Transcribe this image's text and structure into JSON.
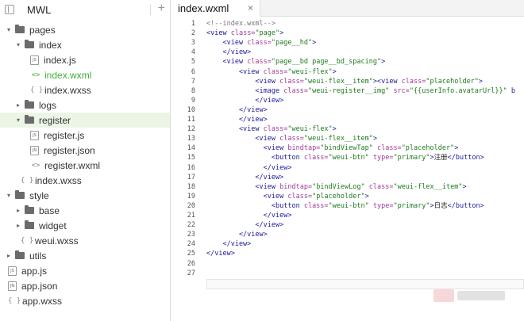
{
  "project": {
    "name": "MWL",
    "add_symbol": "+"
  },
  "tree": [
    {
      "label": "pages",
      "kind": "folder",
      "arrow": "▾",
      "depth": 0
    },
    {
      "label": "index",
      "kind": "folder",
      "arrow": "▾",
      "depth": 1
    },
    {
      "label": "index.js",
      "kind": "file",
      "badge": "JS",
      "depth": 2
    },
    {
      "label": "index.wxml",
      "kind": "code",
      "badge": "<>",
      "depth": 2,
      "active": true
    },
    {
      "label": "index.wxss",
      "kind": "brace",
      "badge": "{ }",
      "depth": 2
    },
    {
      "label": "logs",
      "kind": "folder",
      "arrow": "▸",
      "depth": 1
    },
    {
      "label": "register",
      "kind": "folder",
      "arrow": "▾",
      "depth": 1,
      "selected": true
    },
    {
      "label": "register.js",
      "kind": "file",
      "badge": "JS",
      "depth": 2
    },
    {
      "label": "register.json",
      "kind": "file",
      "badge": "JN",
      "depth": 2
    },
    {
      "label": "register.wxml",
      "kind": "code",
      "badge": "<>",
      "depth": 2
    },
    {
      "label": "index.wxss",
      "kind": "brace",
      "badge": "{ }",
      "depth": 1
    },
    {
      "label": "style",
      "kind": "folder",
      "arrow": "▾",
      "depth": 0
    },
    {
      "label": "base",
      "kind": "folder",
      "arrow": "▸",
      "depth": 1
    },
    {
      "label": "widget",
      "kind": "folder",
      "arrow": "▸",
      "depth": 1
    },
    {
      "label": "weui.wxss",
      "kind": "brace",
      "badge": "{ }",
      "depth": 1
    },
    {
      "label": "utils",
      "kind": "folder",
      "arrow": "▸",
      "depth": 0
    },
    {
      "label": "app.js",
      "kind": "file",
      "badge": "JS",
      "depth": 0
    },
    {
      "label": "app.json",
      "kind": "file",
      "badge": "JN",
      "depth": 0
    },
    {
      "label": "app.wxss",
      "kind": "brace",
      "badge": "{ }",
      "depth": 0
    }
  ],
  "editor": {
    "tab_label": "index.wxml",
    "tab_close": "×",
    "lines": [
      [
        [
          "cm",
          "<!--index.wxml-->"
        ]
      ],
      [
        [
          "tag",
          "<view "
        ],
        [
          "at",
          "class="
        ],
        [
          "st",
          "\"page\""
        ],
        [
          "tag",
          ">"
        ]
      ],
      [
        [
          "tag",
          "    <view "
        ],
        [
          "at",
          "class="
        ],
        [
          "st",
          "\"page__hd\""
        ],
        [
          "tag",
          ">"
        ]
      ],
      [
        [
          "tag",
          "    </view>"
        ]
      ],
      [
        [
          "tag",
          "    <view "
        ],
        [
          "at",
          "class="
        ],
        [
          "st",
          "\"page__bd page__bd_spacing\""
        ],
        [
          "tag",
          ">"
        ]
      ],
      [
        [
          "tag",
          "        <view "
        ],
        [
          "at",
          "class="
        ],
        [
          "st",
          "\"weui-flex\""
        ],
        [
          "tag",
          ">"
        ]
      ],
      [
        [
          "tag",
          "            <view "
        ],
        [
          "at",
          "class="
        ],
        [
          "st",
          "\"weui-flex__item\""
        ],
        [
          "tag",
          "><view "
        ],
        [
          "at",
          "class="
        ],
        [
          "st",
          "\"placeholder\""
        ],
        [
          "tag",
          ">"
        ]
      ],
      [
        [
          "tag",
          "            <image "
        ],
        [
          "at",
          "class="
        ],
        [
          "st",
          "\"weui-register__img\""
        ],
        [
          "tag",
          " "
        ],
        [
          "at",
          "src="
        ],
        [
          "st",
          "\"{{userInfo.avatarUrl}}\""
        ],
        [
          "tag",
          " b"
        ]
      ],
      [
        [
          "tag",
          "            </view>"
        ]
      ],
      [
        [
          "tag",
          "        </view>"
        ]
      ],
      [
        [
          "tag",
          "        </view>"
        ]
      ],
      [
        [
          "tag",
          "        <view "
        ],
        [
          "at",
          "class="
        ],
        [
          "st",
          "\"weui-flex\""
        ],
        [
          "tag",
          ">"
        ]
      ],
      [
        [
          "tag",
          "            <view "
        ],
        [
          "at",
          "class="
        ],
        [
          "st",
          "\"weui-flex__item\""
        ],
        [
          "tag",
          ">"
        ]
      ],
      [
        [
          "tag",
          "              <view "
        ],
        [
          "at",
          "bindtap="
        ],
        [
          "st",
          "\"bindViewTap\""
        ],
        [
          "tag",
          " "
        ],
        [
          "at",
          "class="
        ],
        [
          "st",
          "\"placeholder\""
        ],
        [
          "tag",
          ">"
        ]
      ],
      [
        [
          "tag",
          "                <button "
        ],
        [
          "at",
          "class="
        ],
        [
          "st",
          "\"weui-btn\""
        ],
        [
          "tag",
          " "
        ],
        [
          "at",
          "type="
        ],
        [
          "st",
          "\"primary\""
        ],
        [
          "tag",
          ">"
        ],
        [
          "tx",
          "注册"
        ],
        [
          "tag",
          "</button>"
        ]
      ],
      [
        [
          "tag",
          "              </view>"
        ]
      ],
      [
        [
          "tag",
          "            </view>"
        ]
      ],
      [
        [
          "tag",
          "            <view "
        ],
        [
          "at",
          "bindtap="
        ],
        [
          "st",
          "\"bindViewLog\""
        ],
        [
          "tag",
          " "
        ],
        [
          "at",
          "class="
        ],
        [
          "st",
          "\"weui-flex__item\""
        ],
        [
          "tag",
          ">"
        ]
      ],
      [
        [
          "tag",
          "              <view "
        ],
        [
          "at",
          "class="
        ],
        [
          "st",
          "\"placeholder\""
        ],
        [
          "tag",
          ">"
        ]
      ],
      [
        [
          "tag",
          "                <button "
        ],
        [
          "at",
          "class="
        ],
        [
          "st",
          "\"weui-btn\""
        ],
        [
          "tag",
          " "
        ],
        [
          "at",
          "type="
        ],
        [
          "st",
          "\"primary\""
        ],
        [
          "tag",
          ">"
        ],
        [
          "tx",
          "日志"
        ],
        [
          "tag",
          "</button>"
        ]
      ],
      [
        [
          "tag",
          "              </view>"
        ]
      ],
      [
        [
          "tag",
          "            </view>"
        ]
      ],
      [
        [
          "tag",
          "        </view>"
        ]
      ],
      [
        [
          "tag",
          "    </view>"
        ]
      ],
      [
        [
          "tag",
          "</view>"
        ]
      ],
      [],
      []
    ]
  }
}
